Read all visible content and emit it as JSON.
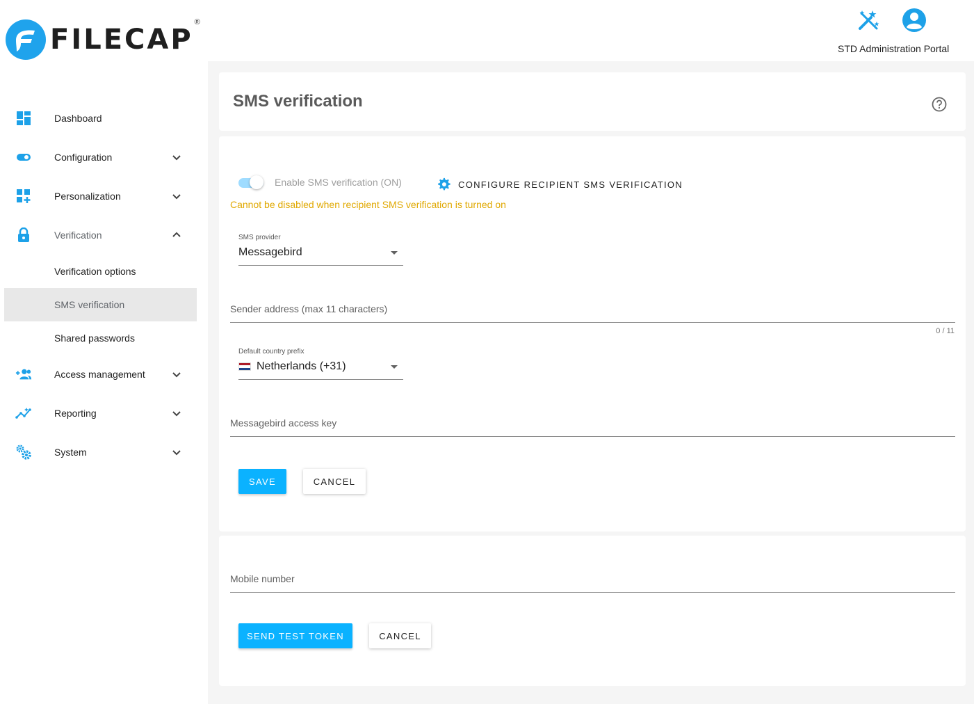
{
  "header": {
    "logo_text": "FILECAP",
    "logo_reg": "®",
    "portal_label": "STD Administration Portal",
    "icons": [
      "wand-icon",
      "account-circle-icon"
    ]
  },
  "sidebar": {
    "items": [
      {
        "label": "Dashboard",
        "icon": "dashboard-icon"
      },
      {
        "label": "Configuration",
        "icon": "toggle-icon"
      },
      {
        "label": "Personalization",
        "icon": "widgets-add-icon"
      },
      {
        "label": "Verification",
        "icon": "lock-icon"
      },
      {
        "label": "Access management",
        "icon": "group-add-icon"
      },
      {
        "label": "Reporting",
        "icon": "insights-icon"
      },
      {
        "label": "System",
        "icon": "settings-gears-icon"
      }
    ],
    "sub_items": [
      {
        "label": "Verification options"
      },
      {
        "label": "SMS verification"
      },
      {
        "label": "Shared passwords"
      }
    ]
  },
  "main": {
    "title": "SMS verification",
    "form": {
      "toggle_label": "Enable SMS verification (ON)",
      "toggle_on": true,
      "config_link": "CONFIGURE RECIPIENT SMS VERIFICATION",
      "warning": "Cannot be disabled when recipient SMS verification is turned on",
      "provider_label": "SMS provider",
      "provider_value": "Messagebird",
      "sender_placeholder": "Sender address (max 11 characters)",
      "sender_counter": "0 / 11",
      "country_label": "Default country prefix",
      "country_value": "Netherlands (+31)",
      "access_key_placeholder": "Messagebird access key",
      "save_label": "SAVE",
      "cancel_label": "CANCEL"
    },
    "test": {
      "mobile_placeholder": "Mobile number",
      "send_label": "SEND TEST TOKEN",
      "cancel_label": "CANCEL"
    }
  },
  "colors": {
    "accent": "#0bb2ff",
    "warning": "#e0a800",
    "sidebar_icon": "#1da1e8"
  }
}
